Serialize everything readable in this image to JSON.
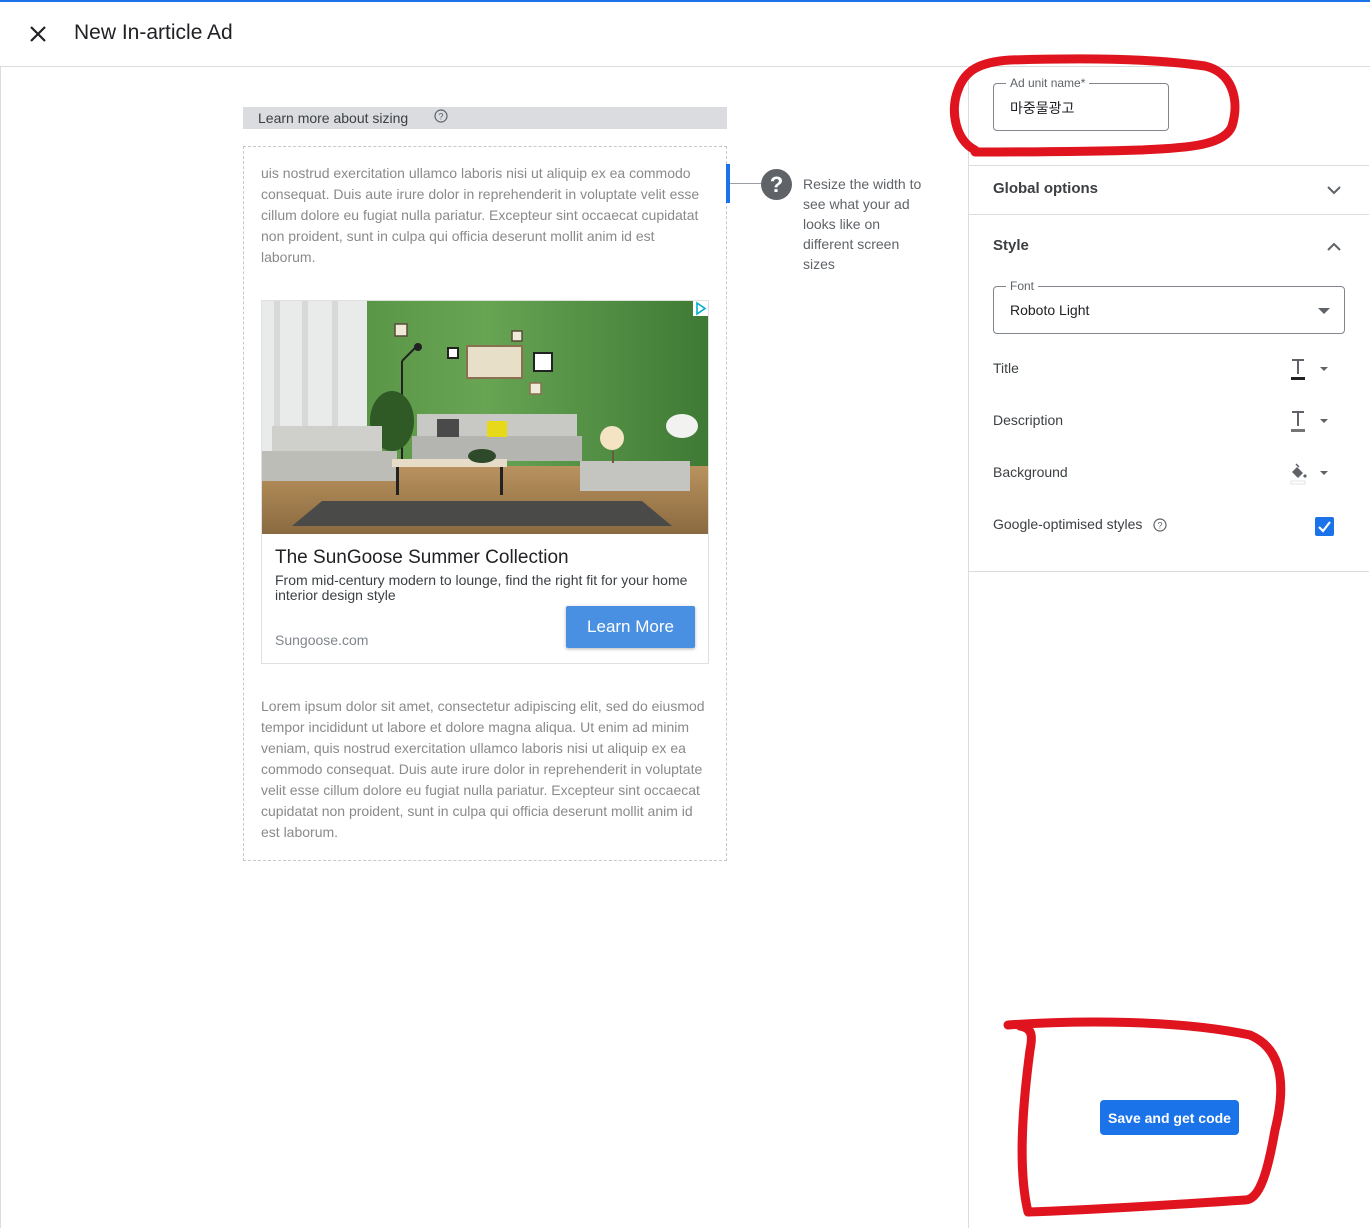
{
  "header": {
    "title": "New In-article Ad"
  },
  "preview": {
    "sizing_link": "Learn more about sizing",
    "resize_hint": "Resize the width to see what your ad looks like on different screen sizes",
    "lorem_top": "uis nostrud exercitation ullamco laboris nisi ut aliquip ex ea commodo consequat. Duis aute irure dolor in reprehenderit in voluptate velit esse cillum dolore eu fugiat nulla pariatur. Excepteur sint occaecat cupidatat non proident, sunt in culpa qui officia deserunt mollit anim id est laborum.",
    "lorem_bottom": "Lorem ipsum dolor sit amet, consectetur adipiscing elit, sed do eiusmod tempor incididunt ut labore et dolore magna aliqua. Ut enim ad minim veniam, quis nostrud exercitation ullamco laboris nisi ut aliquip ex ea commodo consequat. Duis aute irure dolor in reprehenderit in voluptate velit esse cillum dolore eu fugiat nulla pariatur. Excepteur sint occaecat cupidatat non proident, sunt in culpa qui officia deserunt mollit anim id est laborum.",
    "ad": {
      "title": "The SunGoose Summer Collection",
      "description": "From mid-century modern to lounge, find the right fit for your home interior design style",
      "domain": "Sungoose.com",
      "cta": "Learn More"
    }
  },
  "panel": {
    "ad_unit_name": {
      "label": "Ad unit name*",
      "value": "마중물광고"
    },
    "global_options": "Global options",
    "style": {
      "title": "Style",
      "font_label": "Font",
      "font_value": "Roboto Light",
      "rows": {
        "title": "Title",
        "description": "Description",
        "background": "Background"
      },
      "google_optimised": "Google-optimised styles",
      "google_optimised_checked": true
    },
    "save_button": "Save and get code"
  },
  "colors": {
    "accent": "#1a73e8",
    "cta": "#4a90e2",
    "annotation": "#e0141e"
  }
}
